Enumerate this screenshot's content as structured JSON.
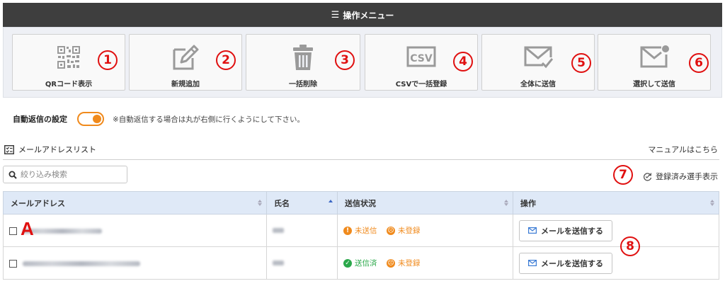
{
  "menu": {
    "title": "操作メニュー",
    "items": [
      {
        "label": "QRコード表示",
        "number": "1",
        "icon": "qr-code-icon"
      },
      {
        "label": "新規追加",
        "number": "2",
        "icon": "edit-icon"
      },
      {
        "label": "一括削除",
        "number": "3",
        "icon": "trash-icon"
      },
      {
        "label": "CSVで一括登録",
        "number": "4",
        "icon": "csv-icon"
      },
      {
        "label": "全体に送信",
        "number": "5",
        "icon": "mail-check-icon"
      },
      {
        "label": "選択して送信",
        "number": "6",
        "icon": "mail-dot-icon"
      }
    ]
  },
  "auto_reply": {
    "label": "自動返信の設定",
    "enabled": true,
    "note": "※自動返信する場合は丸が右側に行くようにして下さい。"
  },
  "list": {
    "title": "メールアドレスリスト",
    "manual_link": "マニュアルはこちら",
    "search_placeholder": "絞り込み検索",
    "registered_number": "7",
    "registered_label": "登録済み選手表示",
    "columns": [
      "メールアドレス",
      "氏名",
      "送信状況",
      "操作"
    ],
    "send_number": "8",
    "row_marker": "A",
    "rows": [
      {
        "status_send": "未送信",
        "status_reg": "未登録",
        "button": "メールを送信する"
      },
      {
        "status_send": "送信済",
        "status_reg": "未登録",
        "button": "メールを送信する"
      }
    ]
  },
  "colors": {
    "accent_orange": "#f08a1c",
    "badge_red": "#e01010",
    "sent_green": "#2aa84a",
    "header_dark": "#3e3e3e",
    "table_header": "#dfe9f7"
  }
}
